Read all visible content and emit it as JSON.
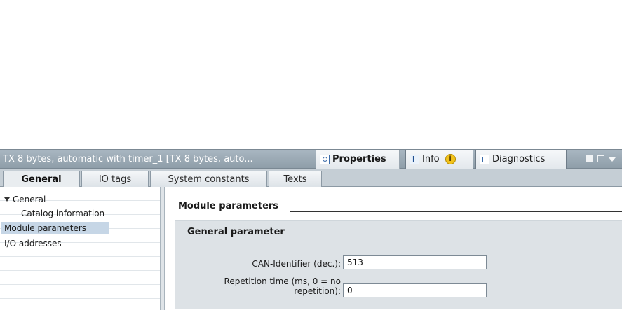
{
  "inspector": {
    "title": "TX 8 bytes, automatic with timer_1 [TX 8 bytes, auto...",
    "tabs": {
      "properties": "Properties",
      "info": "Info",
      "diagnostics": "Diagnostics"
    },
    "icons": [
      "properties-icon",
      "info-icon",
      "info-badge-icon",
      "diagnostics-icon",
      "float-window-icon",
      "maximize-icon",
      "menu-chevron-icon"
    ]
  },
  "sub_tabs": [
    "General",
    "IO tags",
    "System constants",
    "Texts"
  ],
  "active_sub_tab": "General",
  "nav": {
    "items": [
      {
        "label": "General",
        "expanded": true
      },
      {
        "label": "Catalog information"
      },
      {
        "label": "Module parameters",
        "selected": true
      },
      {
        "label": "I/O addresses"
      }
    ]
  },
  "main": {
    "section_title": "Module parameters",
    "group_title": "General parameter",
    "fields": [
      {
        "label": "CAN-Identifier (dec.):",
        "value": "513"
      },
      {
        "label_line1": "Repetition time (ms, 0 = no",
        "label_line2": "repetition):",
        "value": "0"
      }
    ]
  }
}
